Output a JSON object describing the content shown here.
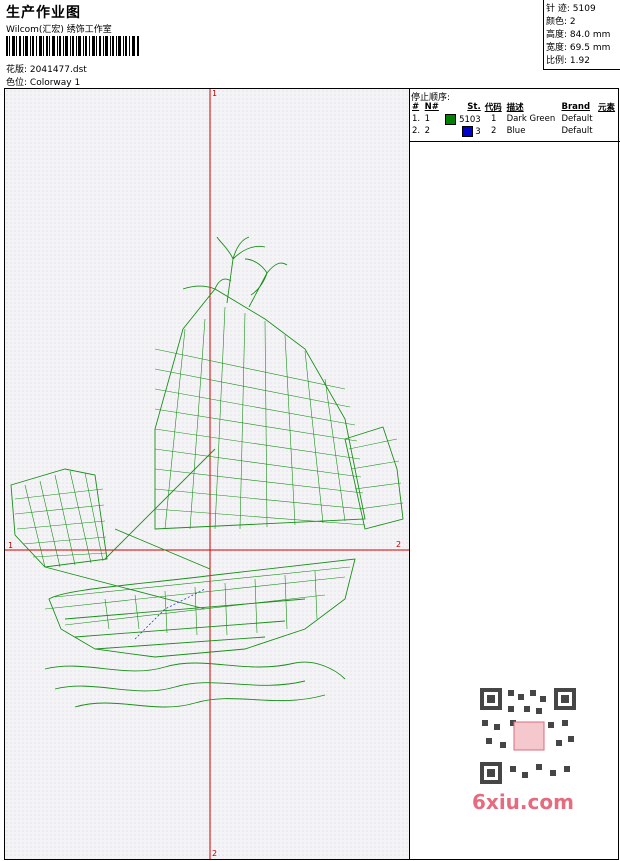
{
  "header": {
    "title": "生产作业图",
    "company": "Wilcom(汇宏) 绣饰工作室",
    "design_label": "花版:",
    "design_file": "2041477.dst",
    "color_label": "色位:",
    "colorway": "Colorway 1"
  },
  "stats": {
    "stitches_label": "针 迹:",
    "stitches": "5109",
    "colors_label": "颜色:",
    "colors": "2",
    "height_label": "高度:",
    "height": "84.0 mm",
    "width_label": "宽度:",
    "width": "69.5 mm",
    "ratio_label": "比例:",
    "ratio": "1.92"
  },
  "stop_sequence": {
    "title": "停止顺序:",
    "columns": [
      "#",
      "N#",
      "St.",
      "代码",
      "描述",
      "Brand",
      "元素"
    ],
    "rows": [
      {
        "idx": "1.",
        "n": "1",
        "color": "#008000",
        "st": "5103",
        "code": "1",
        "desc": "Dark Green",
        "brand": "Default"
      },
      {
        "idx": "2.",
        "n": "2",
        "color": "#0000cc",
        "st": "3",
        "code": "2",
        "desc": "Blue",
        "brand": "Default"
      }
    ]
  },
  "axes": {
    "top_marker": "1",
    "bottom_marker": "2",
    "left_marker": "1",
    "right_marker": "2",
    "color": "#d40000"
  },
  "design": {
    "subject": "junk-ship-embroidery",
    "thread_colors": [
      "#008000",
      "#0000cc"
    ]
  },
  "watermark": {
    "text": "6xiu.com"
  }
}
